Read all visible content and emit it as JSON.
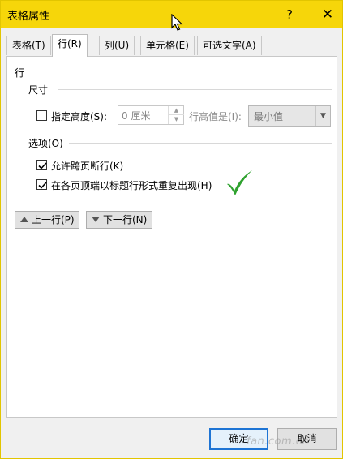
{
  "window": {
    "title": "表格属性",
    "help_label": "?",
    "close_label": "✕"
  },
  "tabs": [
    {
      "label": "表格(T)",
      "active": false
    },
    {
      "label": "行(R)",
      "active": true
    },
    {
      "label": "列(U)",
      "active": false
    },
    {
      "label": "单元格(E)",
      "active": false
    },
    {
      "label": "可选文字(A)",
      "active": false
    }
  ],
  "row_panel": {
    "heading": "行",
    "size_section": "尺寸",
    "specify_height": {
      "label": "指定高度(S):",
      "checked": false
    },
    "height_input": {
      "value": "0 厘米"
    },
    "height_is_label": "行高值是(I):",
    "height_mode_select": {
      "value": "最小值"
    },
    "options_section": "选项(O)",
    "allow_break": {
      "label": "允许跨页断行(K)",
      "checked": true
    },
    "repeat_header": {
      "label": "在各页顶端以标题行形式重复出现(H)",
      "checked": true
    },
    "prev_row_button": "上一行(P)",
    "next_row_button": "下一行(N)"
  },
  "footer": {
    "ok_label": "确定",
    "cancel_label": "取消"
  },
  "watermark": "fan.com.cn",
  "colors": {
    "titlebar": "#f6d60a",
    "checkmark": "#2fa22f",
    "ok_border": "#1e74d4"
  },
  "icons": {
    "help": "question-mark",
    "close": "close-x",
    "prev_row": "triangle-up",
    "next_row": "triangle-down",
    "select_arrow": "chevron-down",
    "annotation": "green-checkmark",
    "cursor": "mouse-pointer"
  }
}
